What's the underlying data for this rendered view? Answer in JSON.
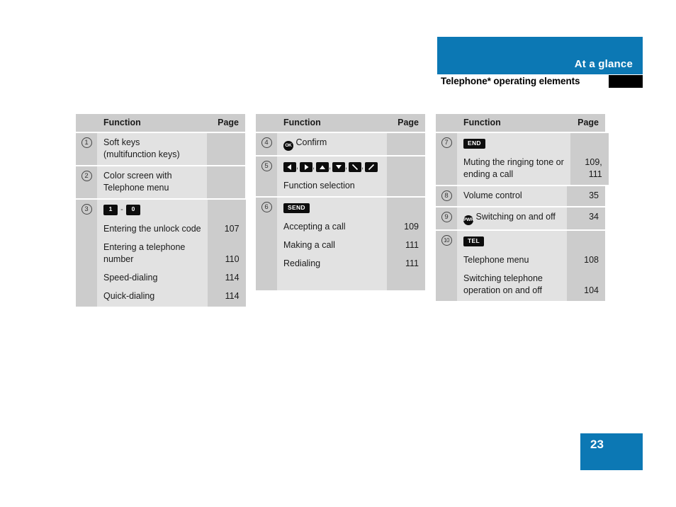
{
  "header": {
    "banner_title": "At a glance",
    "section_title": "Telephone* operating elements"
  },
  "footer": {
    "page_number": "23"
  },
  "colors": {
    "brand_blue": "#0c78b4",
    "header_gray": "#cccccc",
    "function_gray": "#e2e2e2",
    "page_gray": "#cccccc",
    "badge_black": "#0d0d0d"
  },
  "columns": {
    "headers": {
      "function": "Function",
      "page": "Page"
    }
  },
  "table1": {
    "rows": [
      {
        "num": "1",
        "icons": [],
        "lines": [
          "Soft keys",
          "(multifunction keys)"
        ],
        "pages": [
          "",
          ""
        ]
      },
      {
        "num": "2",
        "icons": [],
        "lines": [
          "Color screen with",
          "Telephone menu"
        ],
        "pages": [
          "",
          ""
        ]
      },
      {
        "num": "3",
        "icons": [
          "key-1",
          "dash",
          "key-0"
        ],
        "lines": [
          "Entering the unlock code",
          "Entering a telephone",
          "number",
          "Speed-dialing",
          "Quick-dialing"
        ],
        "pages": [
          "107",
          "110",
          "114",
          "114"
        ],
        "key_labels": {
          "first": "1",
          "dash": "-",
          "last": "0"
        }
      }
    ]
  },
  "table2": {
    "rows": [
      {
        "num": "4",
        "inline_icon": "OK",
        "lines": [
          "Confirm"
        ],
        "pages": [
          ""
        ]
      },
      {
        "num": "5",
        "arrow_icons": [
          "left-arrow",
          "right-arrow",
          "up-arrow",
          "down-arrow",
          "diagonal-down-right",
          "diagonal-up-right"
        ],
        "lines": [
          "Function selection"
        ],
        "pages": [
          ""
        ]
      },
      {
        "num": "6",
        "badge": "SEND",
        "lines": [
          "Accepting a call",
          "Making a call",
          "Redialing"
        ],
        "pages": [
          "109",
          "111",
          "111"
        ]
      }
    ]
  },
  "table3": {
    "rows": [
      {
        "num": "7",
        "badge": "END",
        "lines": [
          "Muting the ringing tone or",
          "ending a call"
        ],
        "pages": [
          "109,",
          "111"
        ]
      },
      {
        "num": "8",
        "lines": [
          "Volume control"
        ],
        "pages": [
          "35"
        ]
      },
      {
        "num": "9",
        "inline_icon": "PWR",
        "lines": [
          "Switching on and off"
        ],
        "pages": [
          "34"
        ]
      },
      {
        "num": "10",
        "badge": "TEL",
        "lines": [
          "Telephone menu",
          "Switching telephone",
          "operation on and off"
        ],
        "pages": [
          "108",
          "104"
        ]
      }
    ]
  }
}
